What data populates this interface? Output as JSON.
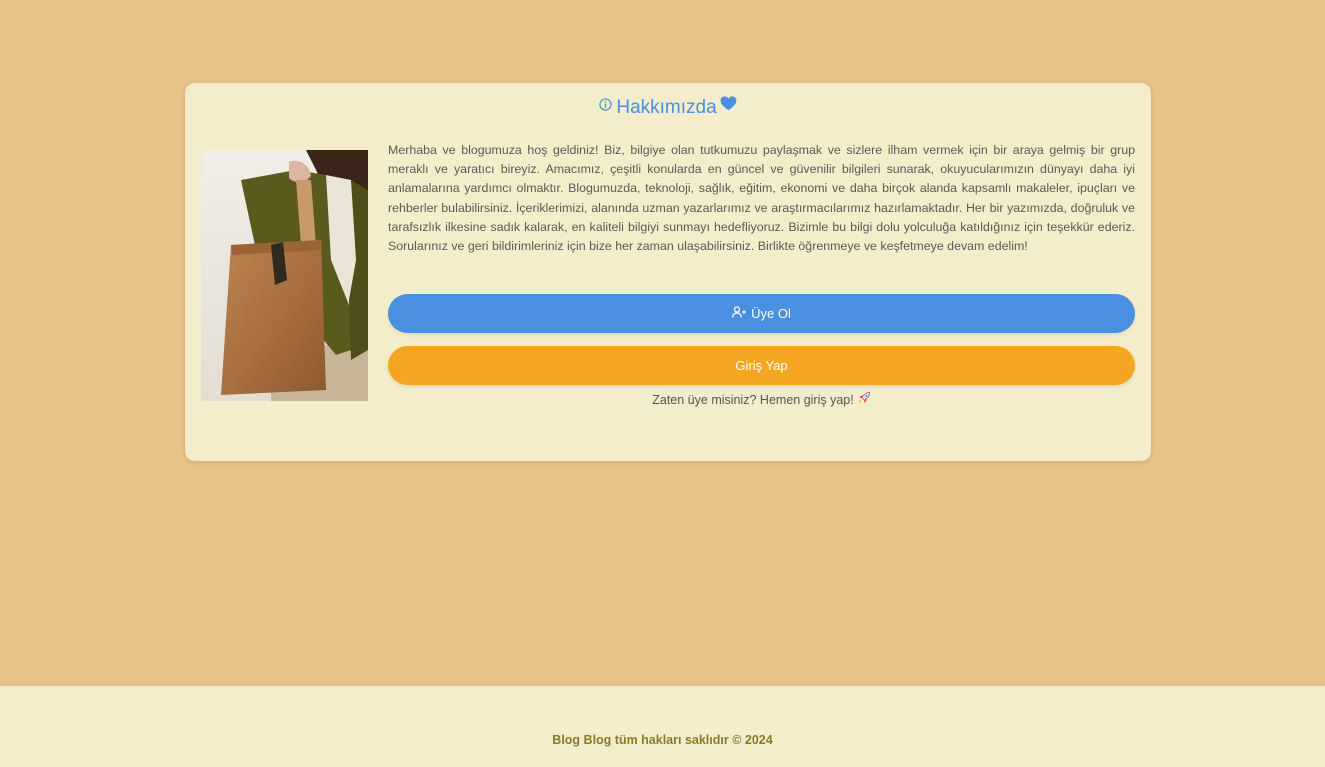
{
  "about": {
    "title": "Hakkımızda",
    "title_icon": "info-circle-icon",
    "title_emoji_icon": "blue-heart-icon",
    "photo_icon": "woman-with-tote-bag-photo",
    "description": "Merhaba ve blogumuza hoş geldiniz! Biz, bilgiye olan tutkumuzu paylaşmak ve sizlere ilham vermek için bir araya gelmiş bir grup meraklı ve yaratıcı bireyiz. Amacımız, çeşitli konularda en güncel ve güvenilir bilgileri sunarak, okuyucularımızın dünyayı daha iyi anlamalarına yardımcı olmaktır. Blogumuzda, teknoloji, sağlık, eğitim, ekonomi ve daha birçok alanda kapsamlı makaleler, ipuçları ve rehberler bulabilirsiniz. İçeriklerimizi, alanında uzman yazarlarımız ve araştırmacılarımız hazırlamaktadır. Her bir yazımızda, doğruluk ve tarafsızlık ilkesine sadık kalarak, en kaliteli bilgiyi sunmayı hedefliyoruz. Bizimle bu bilgi dolu yolculuğa katıldığınız için teşekkür ederiz. Sorularınız ve geri bildirimleriniz için bize her zaman ulaşabilirsiniz. Birlikte öğrenmeye ve keşfetmeye devam edelim!",
    "signup_label": "Üye Ol",
    "signup_icon": "user-plus-icon",
    "login_label": "Giriş Yap",
    "hint": "Zaten üye misiniz? Hemen giriş yap!",
    "hint_icon": "rocket-icon"
  },
  "footer": {
    "text": "Blog Blog tüm hakları saklıdır © 2024"
  },
  "colors": {
    "page_background": "#e7c289",
    "card_background": "#f3edcb",
    "primary_blue": "#4a8fe0",
    "accent_orange": "#f4a623",
    "footer_text": "#8a7a26"
  }
}
